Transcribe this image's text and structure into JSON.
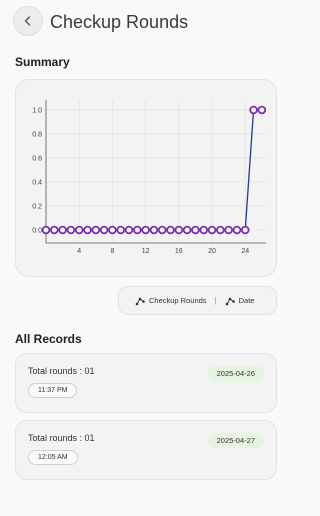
{
  "app_bar": {
    "title": "Checkup Rounds",
    "back_icon": "chevron-left-icon"
  },
  "summary": {
    "title": "Summary"
  },
  "chart_data": {
    "type": "line",
    "x_ticks": [
      "4",
      "8",
      "12",
      "16",
      "20",
      "24"
    ],
    "y_ticks": [
      "0.0",
      "0.2",
      "0.4",
      "0.6",
      "0.8",
      "1.0"
    ],
    "ylim": [
      0,
      1
    ],
    "xlim": [
      0,
      26.5
    ],
    "grid": true,
    "series": [
      {
        "color": "#1f3b8f",
        "marker_color": "#7a2fa8",
        "points": [
          [
            0,
            0
          ],
          [
            1,
            0
          ],
          [
            2,
            0
          ],
          [
            3,
            0
          ],
          [
            4,
            0
          ],
          [
            5,
            0
          ],
          [
            6,
            0
          ],
          [
            7,
            0
          ],
          [
            8,
            0
          ],
          [
            9,
            0
          ],
          [
            10,
            0
          ],
          [
            11,
            0
          ],
          [
            12,
            0
          ],
          [
            13,
            0
          ],
          [
            14,
            0
          ],
          [
            15,
            0
          ],
          [
            16,
            0
          ],
          [
            17,
            0
          ],
          [
            18,
            0
          ],
          [
            19,
            0
          ],
          [
            20,
            0
          ],
          [
            21,
            0
          ],
          [
            22,
            0
          ],
          [
            23,
            0
          ],
          [
            24,
            0
          ],
          [
            25,
            1
          ],
          [
            26,
            1
          ]
        ]
      }
    ]
  },
  "toggles": {
    "rounds_label": "Checkup Rounds",
    "separator": "|",
    "date_label": "Date",
    "icon": "chart-nodes-icon"
  },
  "records": {
    "title": "All Records",
    "items": [
      {
        "total": "Total rounds : 01",
        "time": "11:37 PM",
        "date": "2025-04-26"
      },
      {
        "total": "Total rounds : 01",
        "time": "12:05 AM",
        "date": "2025-04-27"
      }
    ]
  }
}
